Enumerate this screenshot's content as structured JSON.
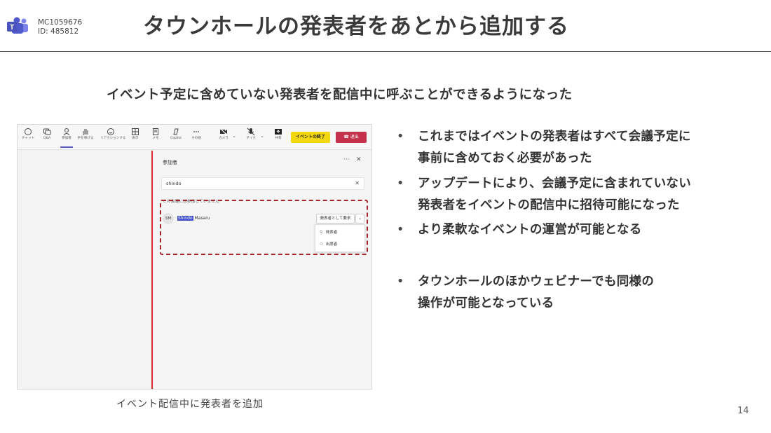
{
  "header": {
    "mc_line1": "MC1059676",
    "mc_line2": "ID: 485812",
    "title": "タウンホールの発表者をあとから追加する"
  },
  "subtitle": "イベント予定に含めていない発表者を配信中に呼ぶことができるようになった",
  "screenshot": {
    "toolbar": [
      {
        "label": "チャット",
        "icon": "chat-icon"
      },
      {
        "label": "Q&A",
        "icon": "qa-icon"
      },
      {
        "label": "参加者",
        "icon": "people-icon"
      },
      {
        "label": "手を挙げる",
        "icon": "raise-hand-icon"
      },
      {
        "label": "リアクションする",
        "icon": "reaction-icon"
      },
      {
        "label": "表示",
        "icon": "view-icon"
      },
      {
        "label": "メモ",
        "icon": "notes-icon"
      },
      {
        "label": "Copilot",
        "icon": "copilot-icon"
      },
      {
        "label": "その他",
        "icon": "more-icon"
      },
      {
        "label": "カメラ",
        "icon": "camera-icon"
      },
      {
        "label": "マイク",
        "icon": "mic-icon"
      },
      {
        "label": "共有",
        "icon": "share-icon"
      }
    ],
    "end_event_label": "イベントの終了",
    "leave_label": "退出",
    "panel": {
      "title": "参加者",
      "more": "···",
      "close": "✕",
      "search_value": "shindo",
      "not_joined_text": "この会議には参加していません",
      "person": {
        "initials": "SM",
        "highlight": "Shindo",
        "rest": " Masaru"
      },
      "request_button": "発表者として要求",
      "menu": [
        {
          "label": "発表者",
          "icon": "presenter-icon"
        },
        {
          "label": "出席者",
          "icon": "attendee-icon"
        }
      ]
    }
  },
  "caption": "イベント配信中に発表者を追加",
  "bullets": [
    {
      "line1": "これまではイベントの発表者はすべて会議予定に",
      "line2": "事前に含めておく必要があった"
    },
    {
      "line1": "アップデートにより、会議予定に含まれていない",
      "line2": "発表者をイベントの配信中に招待可能になった"
    },
    {
      "line1": "より柔軟なイベントの運営が可能となる",
      "line2": ""
    },
    {
      "line1": "タウンホールのほかウェビナーでも同様の",
      "line2": "操作が可能となっている"
    }
  ],
  "bullet_char": "•",
  "page_number": "14",
  "colors": {
    "teams_purple": "#5b5fc7",
    "end_event": "#f3d80f",
    "leave": "#c4314b",
    "highlight_box": "#a3242b"
  }
}
